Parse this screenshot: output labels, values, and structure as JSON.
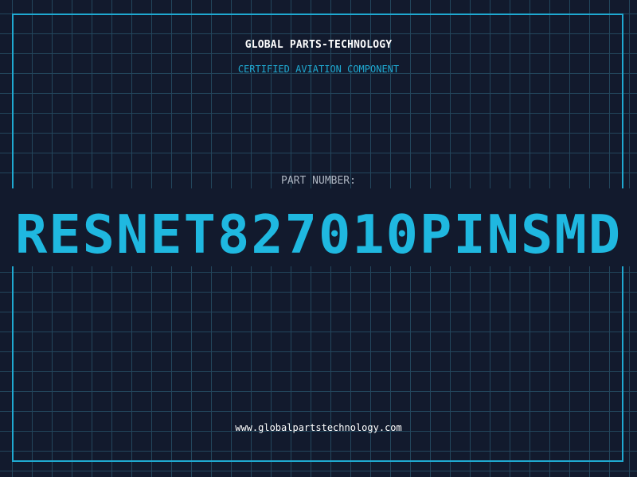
{
  "header": {
    "company": "GLOBAL PARTS-TECHNOLOGY",
    "tagline": "CERTIFIED AVIATION COMPONENT"
  },
  "part": {
    "label": "PART NUMBER:",
    "number": "RESNET827010PINSMD"
  },
  "footer": {
    "website": "www.globalpartstechnology.com"
  },
  "colors": {
    "background": "#121a2d",
    "grid": "#23465c",
    "accent": "#1fa9d1",
    "part_number": "#1fb8e0",
    "text": "#ffffff",
    "muted_text": "#aeb6c2"
  }
}
